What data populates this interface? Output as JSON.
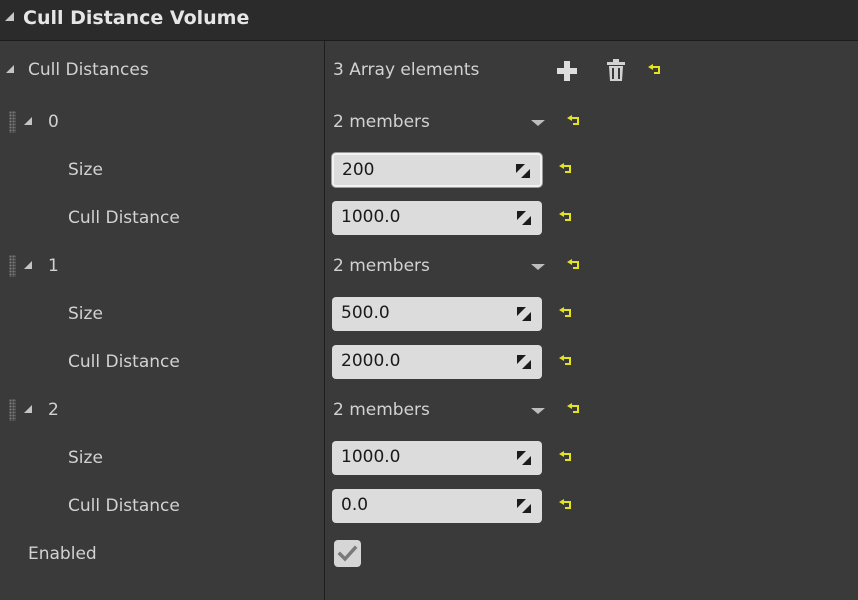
{
  "panel": {
    "title": "Cull Distance Volume"
  },
  "cull_distances": {
    "label": "Cull Distances",
    "count_text": "3 Array elements",
    "elements": [
      {
        "index": "0",
        "members": "2 members",
        "size_label": "Size",
        "size": "200",
        "cull_label": "Cull Distance",
        "cull": "1000.0"
      },
      {
        "index": "1",
        "members": "2 members",
        "size_label": "Size",
        "size": "500.0",
        "cull_label": "Cull Distance",
        "cull": "2000.0"
      },
      {
        "index": "2",
        "members": "2 members",
        "size_label": "Size",
        "size": "1000.0",
        "cull_label": "Cull Distance",
        "cull": "0.0"
      }
    ]
  },
  "enabled": {
    "label": "Enabled",
    "checked": true
  },
  "icons": {
    "add": "plus-icon",
    "delete": "trash-icon",
    "reset": "reset-to-default-icon",
    "expand": "triangle-expanded-icon",
    "dropdown": "dropdown-arrow-icon",
    "spin": "drag-spin-icon",
    "check": "checkmark-icon"
  },
  "colors": {
    "reset_icon": "#e4e41e",
    "background": "#3a3a3a",
    "header": "#2b2b2b",
    "field": "#dcdcdc"
  }
}
